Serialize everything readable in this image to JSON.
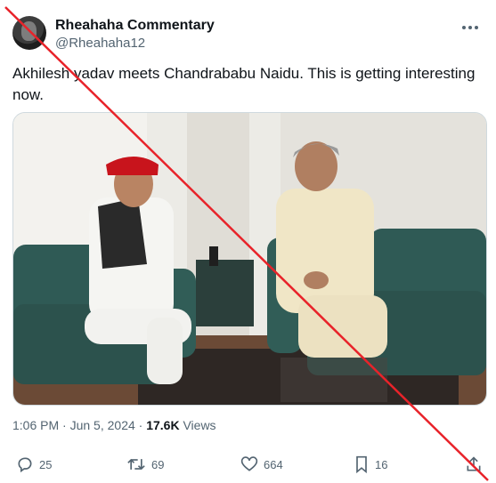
{
  "author": {
    "display_name": "Rheahaha Commentary",
    "handle": "@Rheahaha12"
  },
  "tweet": {
    "text": "Akhilesh yadav meets Chandrababu Naidu. This is getting interesting now."
  },
  "meta": {
    "time": "1:06 PM",
    "separator": "·",
    "date": "Jun 5, 2024",
    "views_count": "17.6K",
    "views_label": "Views"
  },
  "actions": {
    "replies": "25",
    "reposts": "69",
    "likes": "664",
    "bookmarks": "16"
  },
  "colors": {
    "text": "#0f1419",
    "secondary": "#536471",
    "cross_line": "#e8232a"
  },
  "icons": [
    "more-icon",
    "reply-icon",
    "retweet-icon",
    "like-icon",
    "bookmark-icon",
    "share-icon"
  ]
}
